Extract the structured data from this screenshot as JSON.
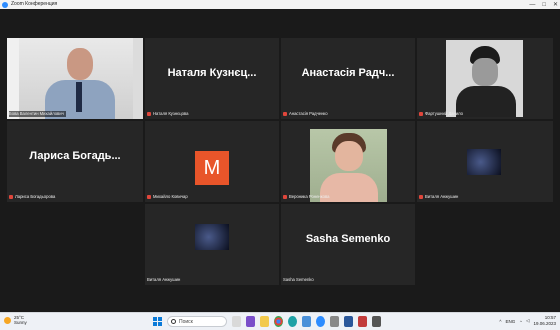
{
  "window": {
    "title": "Zoom Конференция",
    "controls": [
      "—",
      "□",
      "✕"
    ]
  },
  "tiles": [
    {
      "id": "t1",
      "label": "Бова Валентин Михайлович",
      "bigname": "",
      "kind": "video-man",
      "muted": false,
      "active": true
    },
    {
      "id": "t2",
      "label": "Наталя Кузнєцова",
      "bigname": "Наталя Кузнєц...",
      "kind": "name",
      "muted": true,
      "active": false
    },
    {
      "id": "t3",
      "label": "Анастасія Радченко",
      "bigname": "Анастасія Радч...",
      "kind": "name",
      "muted": true,
      "active": false
    },
    {
      "id": "t4",
      "label": "Фартушний Данило",
      "bigname": "",
      "kind": "video-bw",
      "muted": true,
      "active": false
    },
    {
      "id": "t5",
      "label": "Лариса Богадьорова",
      "bigname": "Лариса Богадь...",
      "kind": "name",
      "muted": true,
      "active": false
    },
    {
      "id": "t6",
      "label": "Михайло Ковичар",
      "bigname": "",
      "kind": "avatar",
      "avatar_letter": "M",
      "muted": true,
      "active": false
    },
    {
      "id": "t7",
      "label": "Вероника Роненкова",
      "bigname": "",
      "kind": "video-woman",
      "muted": true,
      "active": false
    },
    {
      "id": "t8",
      "label": "Виталя Анжушин",
      "bigname": "",
      "kind": "thumb",
      "muted": true,
      "active": false
    },
    {
      "id": "t9",
      "label": "Виталя Анжушин",
      "bigname": "",
      "kind": "thumb",
      "muted": false,
      "active": false
    },
    {
      "id": "t10",
      "label": "Sasha Semenko",
      "bigname": "Sasha Semenko",
      "kind": "name",
      "muted": false,
      "active": false
    }
  ],
  "taskbar": {
    "weather_temp": "25°C",
    "weather_text": "Sunny",
    "search_placeholder": "Поиск",
    "lang": "ENG",
    "time": "10:57",
    "date": "19.06.2023"
  },
  "colors": {
    "active_outline": "#d7e63d",
    "avatar_bg": "#e8552a",
    "mic_muted": "#e0463b",
    "tile_bg": "#262626"
  }
}
